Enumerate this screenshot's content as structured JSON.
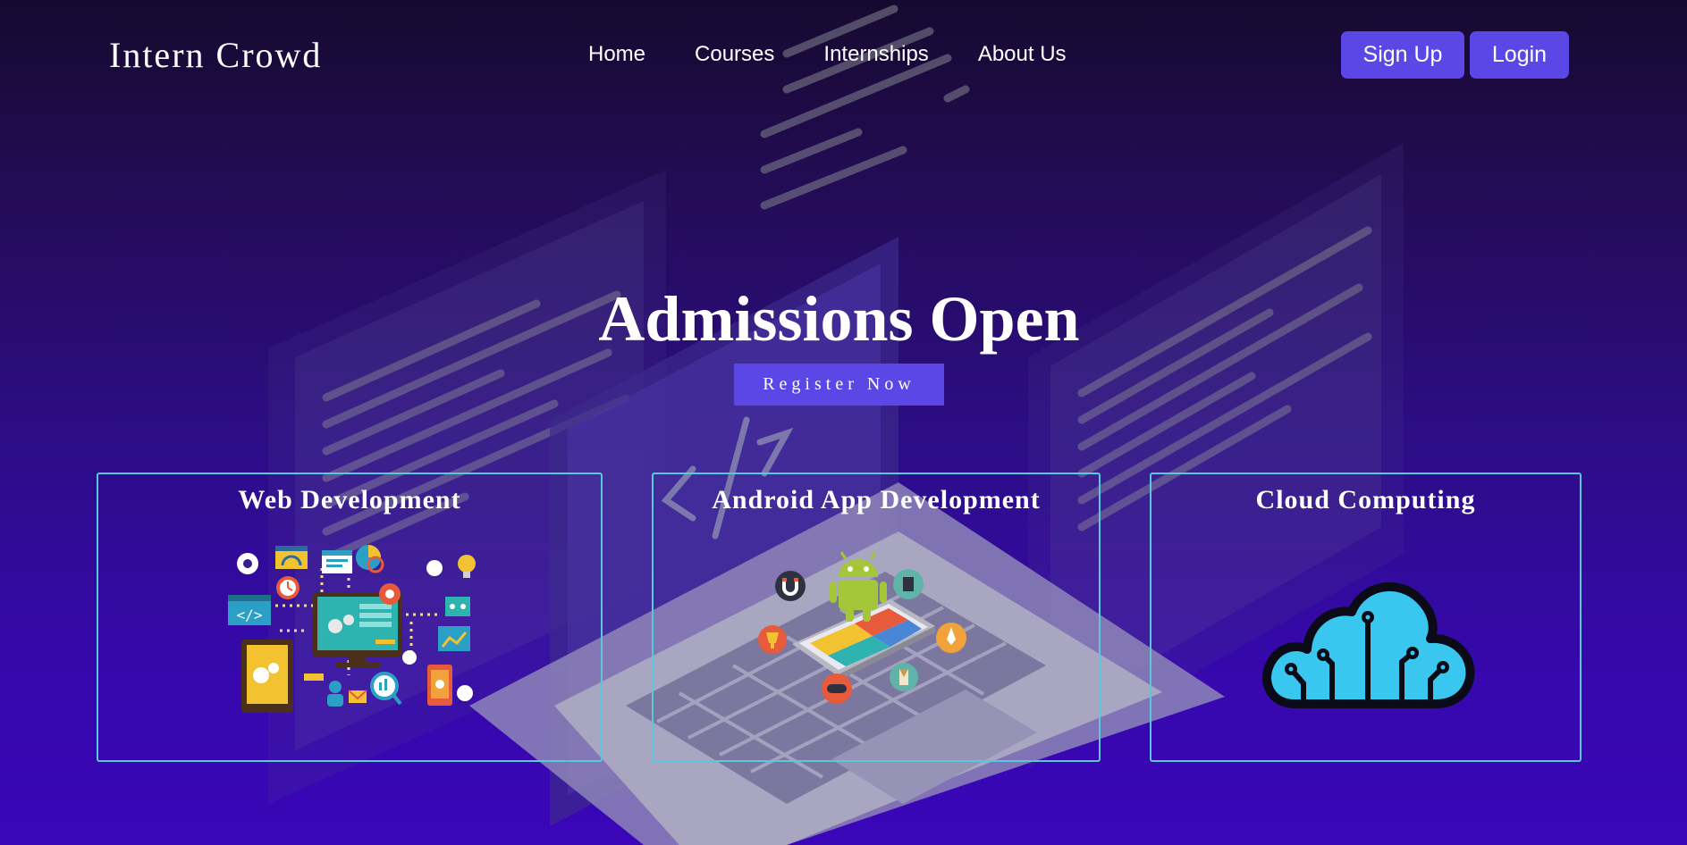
{
  "brand": {
    "name": "Intern Crowd"
  },
  "nav": {
    "items": [
      {
        "label": "Home"
      },
      {
        "label": "Courses"
      },
      {
        "label": "Internships"
      },
      {
        "label": "About Us"
      }
    ]
  },
  "auth": {
    "signup_label": "Sign Up",
    "login_label": "Login"
  },
  "hero": {
    "title": "Admissions Open",
    "cta_label": "Register Now"
  },
  "cards": [
    {
      "title": "Web Development",
      "icon": "web-development-illustration"
    },
    {
      "title": "Android App Development",
      "icon": "android-app-illustration"
    },
    {
      "title": "Cloud Computing",
      "icon": "cloud-computing-icon"
    }
  ],
  "colors": {
    "accent": "#5b46e6",
    "card_border": "#58c9dd",
    "background_top": "#16092f",
    "background_bottom": "#3a06b8"
  }
}
